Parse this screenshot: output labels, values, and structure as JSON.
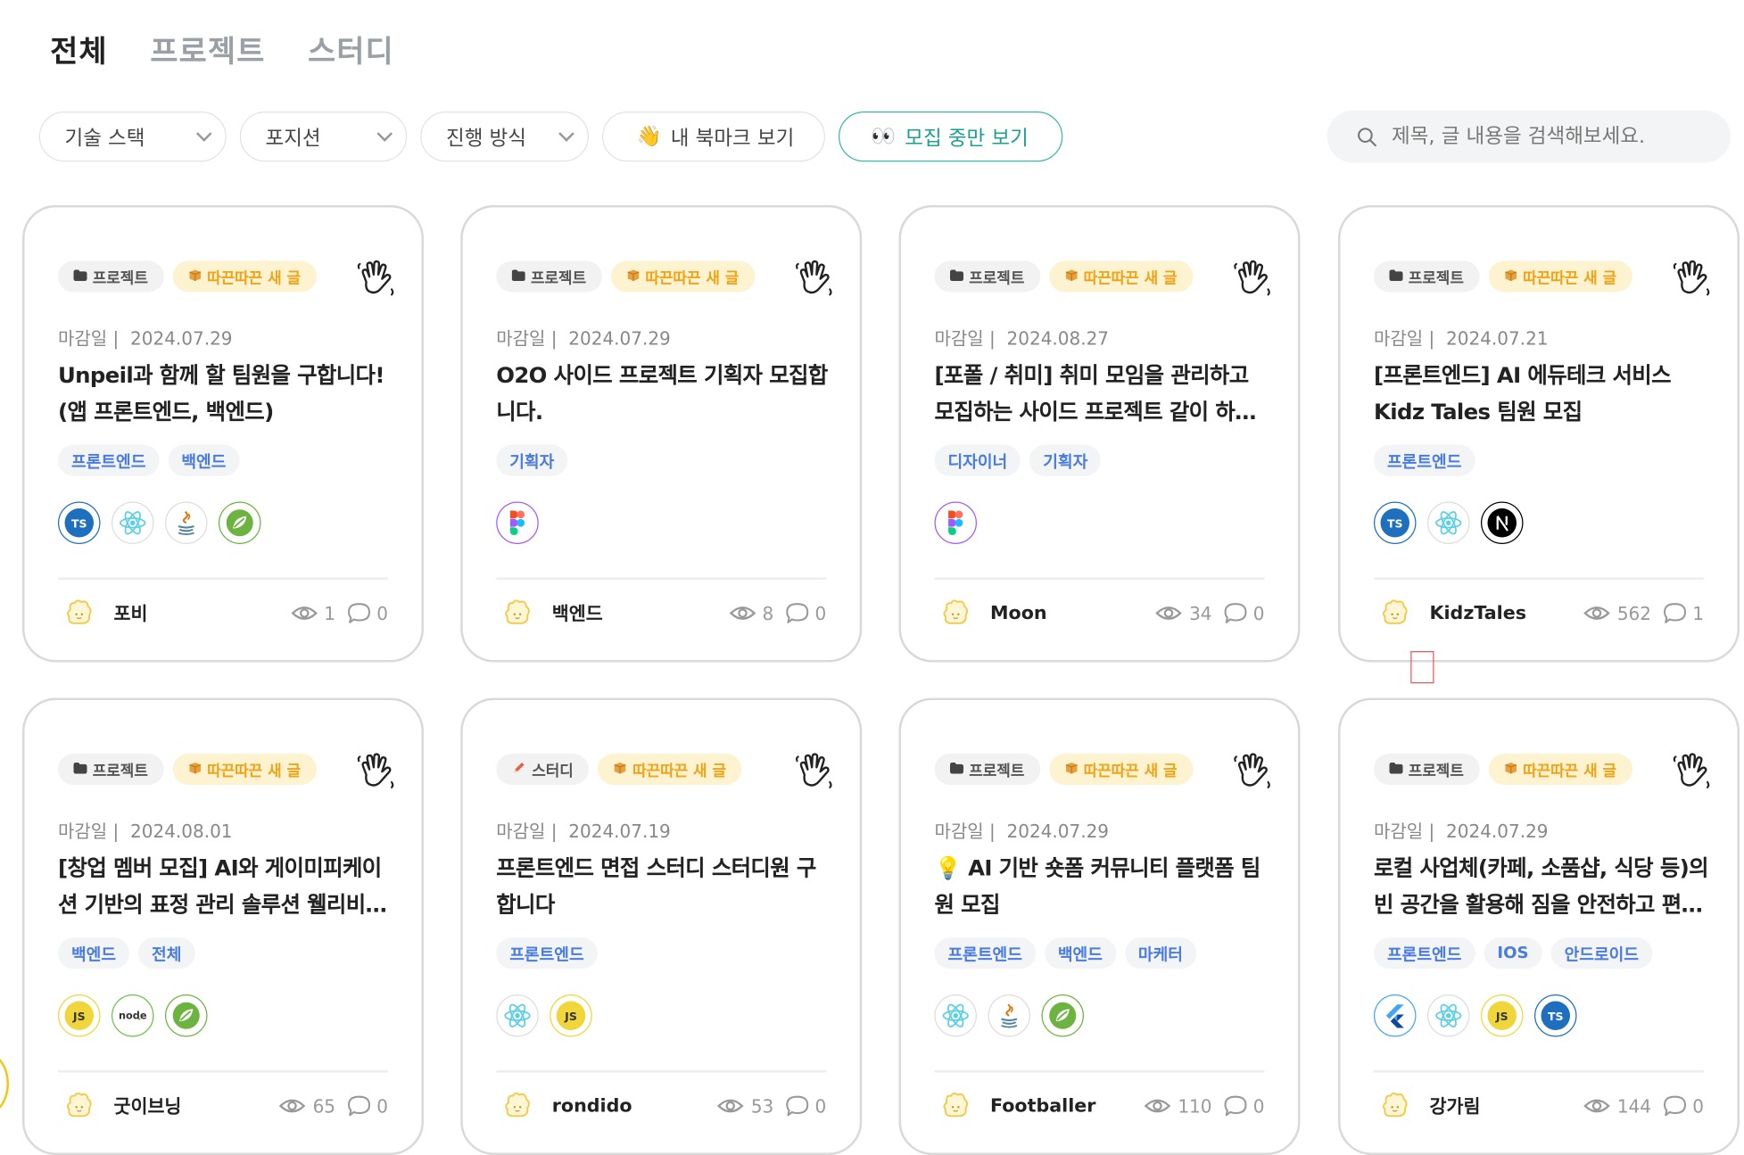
{
  "tabs": [
    {
      "label": "전체",
      "active": true
    },
    {
      "label": "프로젝트",
      "active": false
    },
    {
      "label": "스터디",
      "active": false
    }
  ],
  "filters": {
    "stack": "기술 스택",
    "position": "포지션",
    "mode": "진행 방식",
    "bookmark_emoji": "👋",
    "bookmark": "내 북마크 보기",
    "recruiting_emoji": "👀",
    "recruiting": "모집 중만 보기"
  },
  "search": {
    "placeholder": "제목, 글 내용을 검색해보세요."
  },
  "colors": {
    "accent": "#19a08e",
    "hot_badge_text": "#f0a316",
    "position_text": "#4a7be0"
  },
  "cards": [
    {
      "category": "프로젝트",
      "category_icon": "folder-icon",
      "hot": "따끈따끈 새 글",
      "deadline_label": "마감일 |",
      "deadline": "2024.07.29",
      "title": "Unpeil과 함께 할 팀원을 구합니다! (앱 프론트엔드, 백엔드)",
      "positions": [
        "프론트엔드",
        "백엔드"
      ],
      "techs": [
        "typescript",
        "react",
        "java",
        "spring"
      ],
      "author": "포비",
      "views": "1",
      "comments": "0"
    },
    {
      "category": "프로젝트",
      "category_icon": "folder-icon",
      "hot": "따끈따끈 새 글",
      "deadline_label": "마감일 |",
      "deadline": "2024.07.29",
      "title": "O2O 사이드 프로젝트 기획자 모집합니다.",
      "positions": [
        "기획자"
      ],
      "techs": [
        "figma"
      ],
      "author": "백엔드",
      "views": "8",
      "comments": "0"
    },
    {
      "category": "프로젝트",
      "category_icon": "folder-icon",
      "hot": "따끈따끈 새 글",
      "deadline_label": "마감일 |",
      "deadline": "2024.08.27",
      "title": "[포폴 / 취미] 취미 모임을 관리하고 모집하는 사이드 프로젝트 같이 하실 분 구합니다",
      "positions": [
        "디자이너",
        "기획자"
      ],
      "techs": [
        "figma"
      ],
      "author": "Moon",
      "views": "34",
      "comments": "0"
    },
    {
      "category": "프로젝트",
      "category_icon": "folder-icon",
      "hot": "따끈따끈 새 글",
      "deadline_label": "마감일 |",
      "deadline": "2024.07.21",
      "title": "[프론트엔드] AI 에듀테크 서비스 Kidz Tales 팀원 모집",
      "positions": [
        "프론트엔드"
      ],
      "techs": [
        "typescript",
        "react",
        "nextjs"
      ],
      "author": "KidzTales",
      "views": "562",
      "comments": "1"
    },
    {
      "category": "프로젝트",
      "category_icon": "folder-icon",
      "hot": "따끈따끈 새 글",
      "deadline_label": "마감일 |",
      "deadline": "2024.08.01",
      "title": "[창업 멤버 모집] AI와 게이미피케이션 기반의 표정 관리 솔루션 웰리비(Wellibi) 팀원 모집",
      "positions": [
        "백엔드",
        "전체"
      ],
      "techs": [
        "javascript",
        "nodejs",
        "spring"
      ],
      "author": "굿이브닝",
      "views": "65",
      "comments": "0"
    },
    {
      "category": "스터디",
      "category_icon": "pencil-icon",
      "hot": "따끈따끈 새 글",
      "deadline_label": "마감일 |",
      "deadline": "2024.07.19",
      "title": "프론트엔드 면접 스터디 스터디원 구합니다",
      "positions": [
        "프론트엔드"
      ],
      "techs": [
        "react",
        "javascript"
      ],
      "author": "rondido",
      "views": "53",
      "comments": "0"
    },
    {
      "category": "프로젝트",
      "category_icon": "folder-icon",
      "hot": "따끈따끈 새 글",
      "deadline_label": "마감일 |",
      "deadline": "2024.07.29",
      "title": "💡 AI 기반 숏폼 커뮤니티 플랫폼 팀원 모집",
      "positions": [
        "프론트엔드",
        "백엔드",
        "마케터"
      ],
      "techs": [
        "react",
        "java",
        "spring"
      ],
      "author": "Footballer",
      "views": "110",
      "comments": "0"
    },
    {
      "category": "프로젝트",
      "category_icon": "folder-icon",
      "hot": "따끈따끈 새 글",
      "deadline_label": "마감일 |",
      "deadline": "2024.07.29",
      "title": "로컬 사업체(카페, 소품샵, 식당 등)의 빈 공간을 활용해 짐을 안전하고 편리하게 보관하는 서비스",
      "positions": [
        "프론트엔드",
        "IOS",
        "안드로이드"
      ],
      "techs": [
        "flutter",
        "react",
        "javascript",
        "typescript"
      ],
      "author": "강가림",
      "views": "144",
      "comments": "0"
    }
  ]
}
